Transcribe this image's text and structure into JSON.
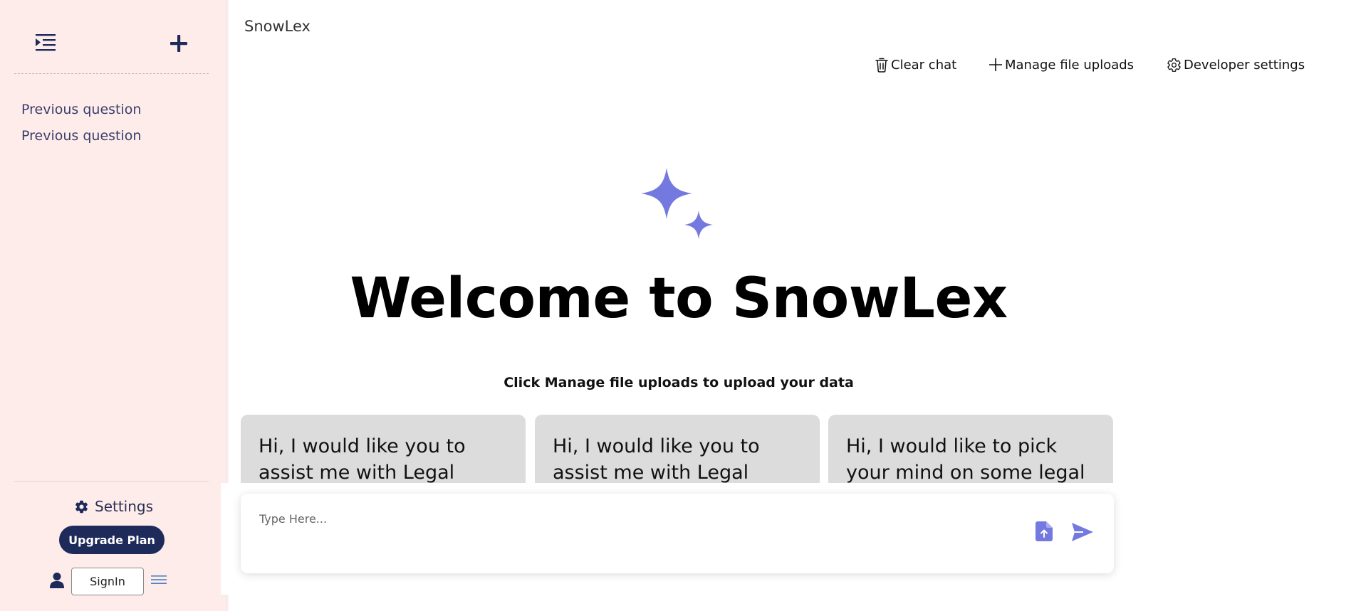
{
  "app": {
    "title": "SnowLex"
  },
  "sidebar": {
    "history": [
      {
        "label": "Previous question"
      },
      {
        "label": "Previous question"
      }
    ],
    "settings_label": "Settings",
    "upgrade_label": "Upgrade Plan",
    "signin_label": "SignIn"
  },
  "toolbar": {
    "clear_label": "Clear chat",
    "manage_label": "Manage file uploads",
    "developer_label": "Developer settings"
  },
  "main": {
    "welcome": "Welcome to SnowLex",
    "hint": "Click Manage file uploads to upload your data",
    "cards": [
      {
        "text": "Hi, I would like you to assist me with Legal Research"
      },
      {
        "text": "Hi, I would like you to assist me with Legal Research and"
      },
      {
        "text": "Hi, I would like to pick your mind on some legal points"
      }
    ]
  },
  "chat": {
    "placeholder": "Type Here..."
  },
  "colors": {
    "sidebar_bg": "#fdecea",
    "brand_navy": "#1e2a5a",
    "accent_purple": "#7479e0",
    "card_bg": "#dcdcdc"
  },
  "icons": {
    "toggle": "indent-menu-icon",
    "new": "plus-icon",
    "settings": "gear-icon",
    "user": "user-icon",
    "menu": "hamburger-icon",
    "clear": "trash-icon",
    "manage": "plus-icon",
    "developer": "gear-icon",
    "logo": "sparkle-icon",
    "upload": "file-upload-icon",
    "send": "send-icon"
  }
}
